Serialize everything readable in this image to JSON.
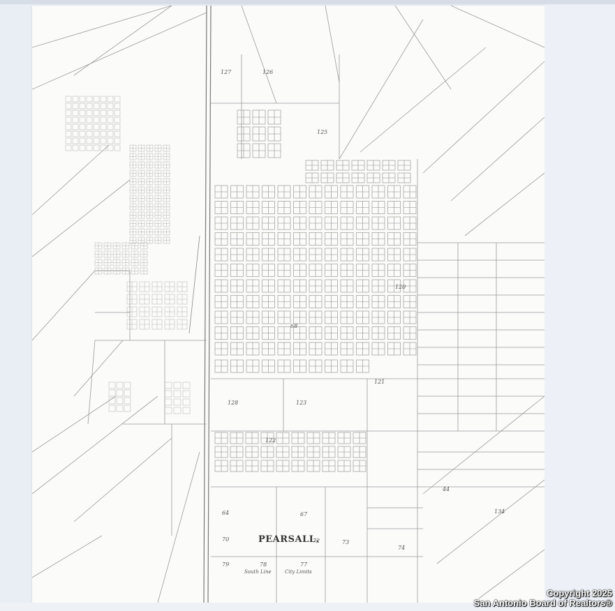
{
  "map": {
    "title": "PEARSALL.",
    "south_limit_label": "South Line",
    "city_limit_label": "City Limits",
    "blocks": [
      {
        "label": "127"
      },
      {
        "label": "126"
      },
      {
        "label": "125"
      },
      {
        "label": "120"
      },
      {
        "label": "121"
      },
      {
        "label": "122"
      },
      {
        "label": "123"
      },
      {
        "label": "128"
      },
      {
        "label": "67"
      },
      {
        "label": "68"
      },
      {
        "label": "70"
      },
      {
        "label": "72"
      },
      {
        "label": "73"
      },
      {
        "label": "74"
      },
      {
        "label": "77"
      },
      {
        "label": "78"
      },
      {
        "label": "79"
      },
      {
        "label": "44"
      },
      {
        "label": "64"
      },
      {
        "label": "134"
      }
    ]
  },
  "watermark": {
    "line1": "Copyright 2025",
    "line2": "San Antonio Board of Realtors®"
  }
}
